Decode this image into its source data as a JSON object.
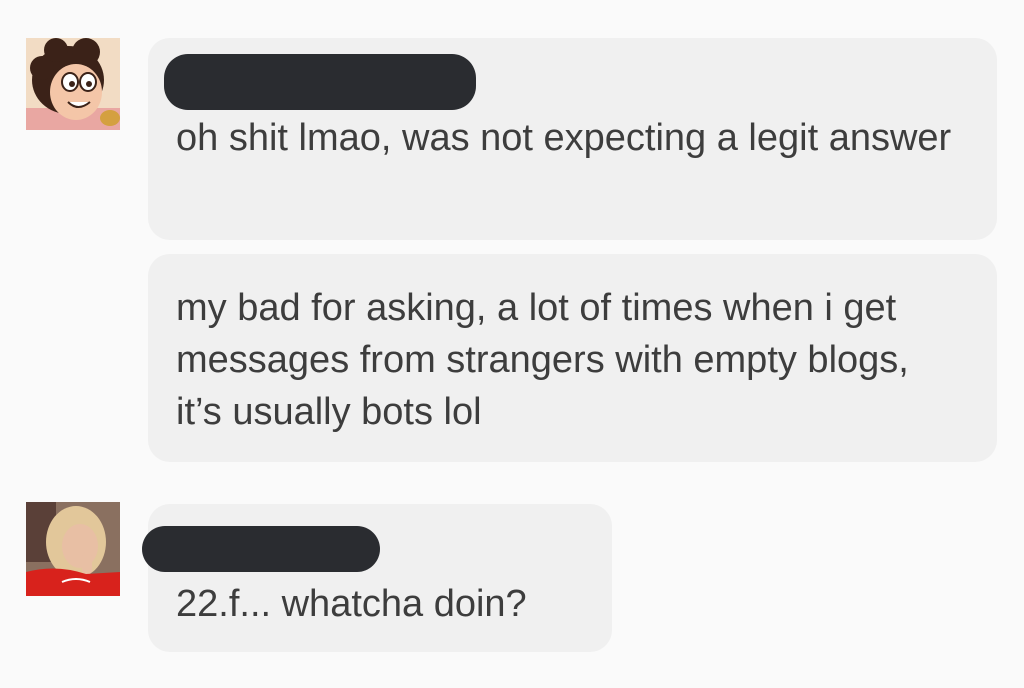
{
  "conversation": {
    "participants": [
      {
        "avatar_icon": "cartoon-boy-avatar",
        "messages": [
          "oh shit lmao, was not expecting a legit answer",
          "my bad for asking, a lot of times when i get messages from strangers with empty blogs, it’s usually bots lol"
        ]
      },
      {
        "avatar_icon": "selfie-photo-avatar",
        "messages": [
          "22.f... whatcha doin?"
        ]
      }
    ]
  },
  "colors": {
    "background": "#fafafa",
    "bubble": "#f0f0f0",
    "redaction": "#2a2c30",
    "text": "#3d3d3d"
  }
}
